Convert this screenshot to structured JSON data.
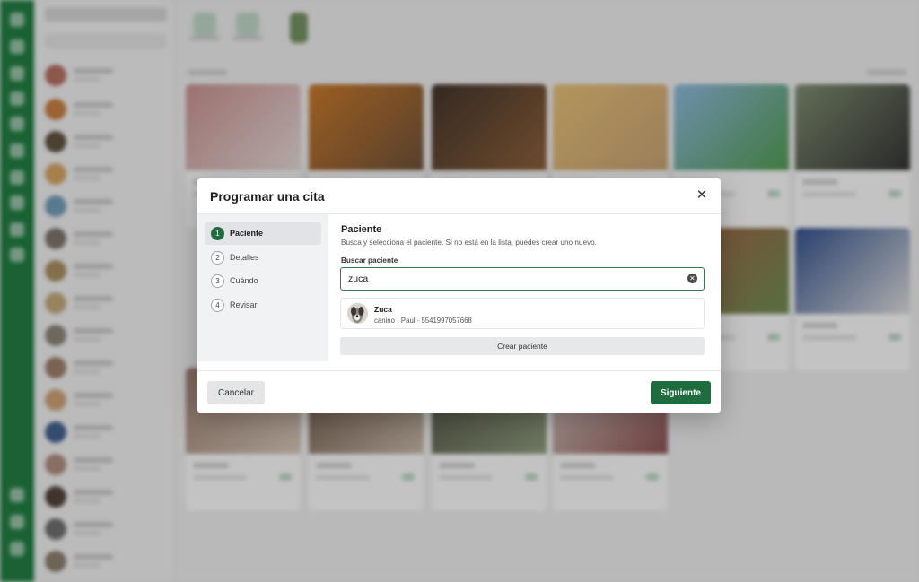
{
  "modal": {
    "title": "Programar una cita",
    "close_icon": "close-icon",
    "steps": [
      {
        "number": "1",
        "label": "Paciente",
        "active": true
      },
      {
        "number": "2",
        "label": "Detalles",
        "active": false
      },
      {
        "number": "3",
        "label": "Cuándo",
        "active": false
      },
      {
        "number": "4",
        "label": "Revisar",
        "active": false
      }
    ],
    "patient_section": {
      "title": "Paciente",
      "description": "Busca y selecciona el paciente. Si no está en la lista, puedes crear uno nuevo.",
      "search_label": "Buscar paciente",
      "search_value": "zuca",
      "clear_icon": "clear-icon",
      "results": [
        {
          "name": "Zuca",
          "meta": "canino · Paul · 5541997057668",
          "avatar": "dog-avatar"
        }
      ],
      "create_button": "Crear paciente"
    },
    "footer": {
      "cancel": "Cancelar",
      "next": "Siguiente"
    }
  },
  "colors": {
    "brand_green": "#1e6d3f",
    "rail_green": "#15793a",
    "focus_border": "#2d7a4b"
  }
}
